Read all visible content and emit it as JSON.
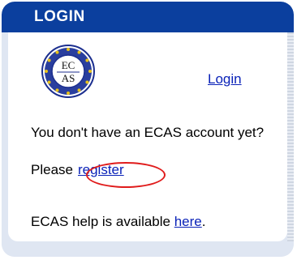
{
  "panel": {
    "title": "LOGIN",
    "header_color": "#0b3f9e",
    "link_color": "#0a22b8",
    "highlight_color": "#e01b1b"
  },
  "logo": {
    "icon": "ecas-seal-icon",
    "line1": "EC",
    "line2": "AS"
  },
  "login_link": "Login",
  "account_message": "You don't have an ECAS account yet?",
  "register": {
    "prefix": "Please",
    "link": "register"
  },
  "help": {
    "prefix": "ECAS help is available ",
    "link": "here",
    "suffix": "."
  }
}
